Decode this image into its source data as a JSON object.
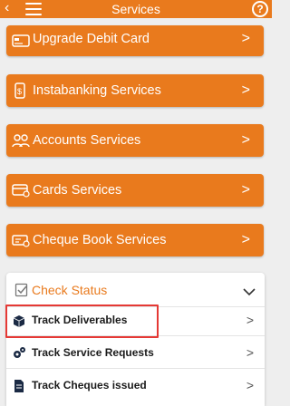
{
  "header": {
    "title": "Services",
    "back_icon": "back-arrow-icon",
    "menu_icon": "hamburger-menu-icon",
    "help_icon": "help-icon",
    "help_glyph": "?"
  },
  "colors": {
    "brand_orange": "#e97a1d",
    "highlight_red": "#e53935"
  },
  "services": [
    {
      "label": "Upgrade Debit Card",
      "icon": "debit-card-icon"
    },
    {
      "label": "Instabanking Services",
      "icon": "mobile-banking-icon"
    },
    {
      "label": "Accounts Services",
      "icon": "accounts-group-icon"
    },
    {
      "label": "Cards Services",
      "icon": "cards-icon"
    },
    {
      "label": "Cheque Book Services",
      "icon": "cheque-book-icon"
    }
  ],
  "check_status": {
    "title": "Check Status",
    "icon": "checklist-icon",
    "items": [
      {
        "label": "Track Deliverables",
        "icon": "package-icon"
      },
      {
        "label": "Track Service Requests",
        "icon": "service-gears-icon"
      },
      {
        "label": "Track Cheques issued",
        "icon": "document-icon"
      }
    ]
  },
  "chevron_glyph": ">"
}
